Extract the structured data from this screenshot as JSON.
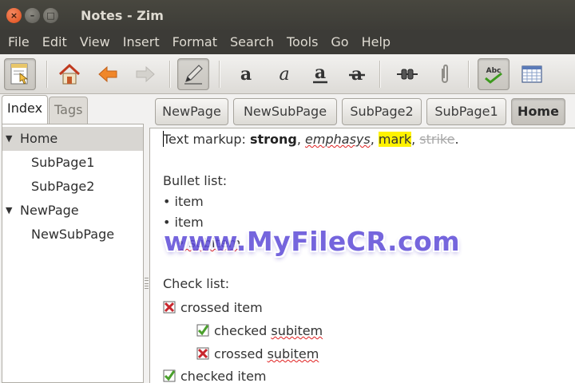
{
  "window": {
    "title": "Notes - Zim",
    "buttons": {
      "close": "×",
      "minimize": "–",
      "maximize": "□"
    }
  },
  "menu": [
    "File",
    "Edit",
    "View",
    "Insert",
    "Format",
    "Search",
    "Tools",
    "Go",
    "Help"
  ],
  "toolbar": {
    "icons": [
      "page-icon",
      "home-icon",
      "back-arrow-icon",
      "forward-arrow-icon",
      "edit-pencil-icon",
      "bold-icon",
      "italic-icon",
      "underline-icon",
      "strikethrough-icon",
      "link-icon",
      "attach-icon",
      "spellcheck-icon",
      "calendar-icon"
    ],
    "glyphs": {
      "bold": "a",
      "italic": "a",
      "underline": "a",
      "strike": "a",
      "spell": "Abc"
    }
  },
  "sidebar": {
    "tabs": [
      "Index",
      "Tags"
    ],
    "active_tab": "Index",
    "tree": [
      {
        "label": "Home",
        "expanded": true,
        "selected": true,
        "level": 0
      },
      {
        "label": "SubPage1",
        "level": 1
      },
      {
        "label": "SubPage2",
        "level": 1
      },
      {
        "label": "NewPage",
        "expanded": true,
        "level": 0
      },
      {
        "label": "NewSubPage",
        "level": 1
      }
    ]
  },
  "pathbar": [
    "NewPage",
    "NewSubPage",
    "SubPage2",
    "SubPage1",
    "Home"
  ],
  "pathbar_active": "Home",
  "editor": {
    "line1": {
      "prefix": "Text markup: ",
      "strong": "strong",
      "sep1": ", ",
      "emph": "emphasys",
      "sep2": ", ",
      "mark": "mark",
      "sep3": ", ",
      "strike": "strike",
      "end": "."
    },
    "bullet_heading": "Bullet list:",
    "bullets": [
      "• item",
      "• item",
      "• subitem"
    ],
    "check_heading": "Check list:",
    "checks": [
      {
        "state": "crossed",
        "label_a": "crossed item",
        "label_b": ""
      },
      {
        "state": "checked",
        "label_a": "checked ",
        "label_b": "subitem"
      },
      {
        "state": "crossed",
        "label_a": "crossed ",
        "label_b": "subitem"
      },
      {
        "state": "checked",
        "label_a": "checked item",
        "label_b": ""
      }
    ]
  },
  "watermark": "www.MyFileCR.com",
  "colors": {
    "accent": "#df4b16",
    "mark": "#fff200",
    "check": "#4aa02c",
    "cross": "#c8262d",
    "watermark": "#5e4bd8"
  }
}
